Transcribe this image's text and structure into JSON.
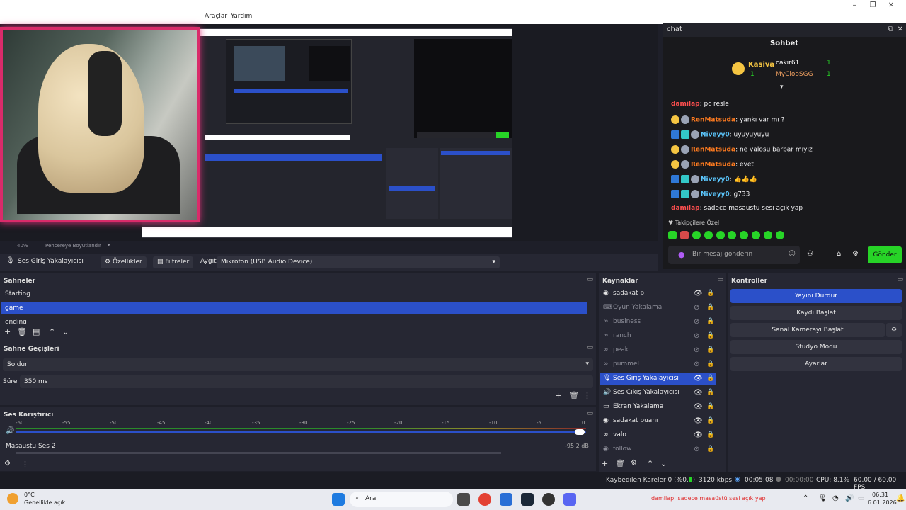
{
  "menu": {
    "tools": "Araçlar",
    "help": "Yardım"
  },
  "preview": {
    "zoom": "40%",
    "resize_label": "Pencereye Boyutlandır"
  },
  "chat": {
    "header_title": "chat",
    "panel_title": "Sohbet",
    "leaderboard": [
      {
        "name": "Kasiva",
        "value": "1"
      },
      {
        "name": "cakir61",
        "value": "1"
      },
      {
        "name": "MyClooSGG",
        "value": "1"
      }
    ],
    "messages": [
      {
        "user": "damilap",
        "text": ": pc resle",
        "color": "#ff4f4f"
      },
      {
        "user": "RenMatsuda",
        "text": ": yankı var mı ?",
        "color": "#ff7b1f"
      },
      {
        "user": "Niveyy0",
        "text": ": uyuyuyuyu",
        "color": "#5cc8ff"
      },
      {
        "user": "RenMatsuda",
        "text": ": ne valosu barbar mıyız",
        "color": "#ff7b1f"
      },
      {
        "user": "RenMatsuda",
        "text": ": evet",
        "color": "#ff7b1f"
      },
      {
        "user": "Niveyy0",
        "text": ": 👍👍👍",
        "color": "#5cc8ff"
      },
      {
        "user": "Niveyy0",
        "text": ": g733",
        "color": "#5cc8ff"
      },
      {
        "user": "damilap",
        "text": ": sadece masaüstü sesi açık yap",
        "color": "#ff4f4f"
      }
    ],
    "followers_label": "Takipçilere Özel",
    "input_placeholder": "Bir mesaj gönderin",
    "send_label": "Gönder"
  },
  "properties_bar": {
    "source_name": "Ses Giriş Yakalayıcısı",
    "properties_label": "Özellikler",
    "filters_label": "Filtreler",
    "device_label": "Aygıt",
    "device_value": "Mikrofon (USB Audio Device)"
  },
  "scenes": {
    "title": "Sahneler",
    "items": [
      "Starting",
      "game",
      "ending"
    ],
    "selected": "game"
  },
  "transitions": {
    "title": "Sahne Geçişleri",
    "type": "Soldur",
    "duration_label": "Süre",
    "duration_value": "350 ms"
  },
  "mixer": {
    "title": "Ses Karıştırıcı",
    "ticks": [
      "-60",
      "-55",
      "-50",
      "-45",
      "-40",
      "-35",
      "-30",
      "-25",
      "-20",
      "-15",
      "-10",
      "-5",
      "0"
    ],
    "channel_name": "Masaüstü Ses 2",
    "channel_db": "-95.2 dB"
  },
  "sources": {
    "title": "Kaynaklar",
    "items": [
      {
        "name": "sadakat p",
        "icon": "globe-icon",
        "visible": true
      },
      {
        "name": "Oyun Yakalama",
        "icon": "gamepad-icon",
        "visible": false
      },
      {
        "name": "business",
        "icon": "link-icon",
        "visible": false
      },
      {
        "name": "ranch",
        "icon": "link-icon",
        "visible": false
      },
      {
        "name": "peak",
        "icon": "link-icon",
        "visible": false
      },
      {
        "name": "pummel",
        "icon": "link-icon",
        "visible": false
      },
      {
        "name": "Ses Giriş Yakalayıcısı",
        "icon": "microphone-icon",
        "visible": true
      },
      {
        "name": "Ses Çıkış Yakalayıcısı",
        "icon": "speaker-icon",
        "visible": true
      },
      {
        "name": "Ekran Yakalama",
        "icon": "monitor-icon",
        "visible": true
      },
      {
        "name": "sadakat puanı",
        "icon": "globe-icon",
        "visible": true
      },
      {
        "name": "valo",
        "icon": "link-icon",
        "visible": true
      },
      {
        "name": "follow",
        "icon": "globe-icon",
        "visible": false
      }
    ],
    "selected": "Ses Giriş Yakalayıcısı"
  },
  "controls": {
    "title": "Kontroller",
    "stop_stream": "Yayını Durdur",
    "start_recording": "Kaydı Başlat",
    "start_virtual_cam": "Sanal Kamerayı Başlat",
    "studio_mode": "Stüdyo Modu",
    "settings": "Ayarlar"
  },
  "status": {
    "dropped_frames": "Kaybedilen Kareler 0 (%0.0)",
    "bitrate": "3120 kbps",
    "stream_time": "00:05:08",
    "record_time": "00:00:00",
    "cpu": "CPU: 8.1%",
    "fps": "60.00 / 60.00 FPS"
  },
  "taskbar": {
    "weather_temp": "0°C",
    "weather_desc": "Genellikle açık",
    "search_placeholder": "Ara",
    "time": "06:31",
    "date": "6.01.2026",
    "ticker": "damilap: sadece masaüstü sesi açık yap"
  },
  "colors": {
    "accent": "#2b50c9",
    "send": "#27d427",
    "highlight_pink": "#d92b6a",
    "dock_bg": "#262733"
  }
}
